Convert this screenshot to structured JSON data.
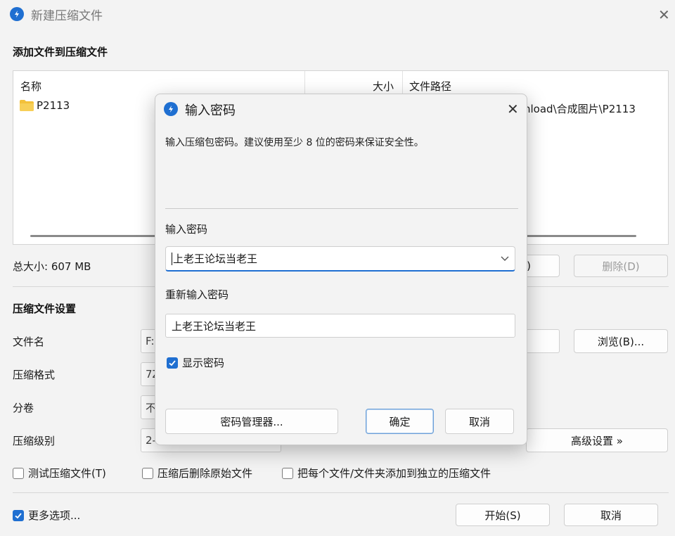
{
  "window": {
    "title": "新建压缩文件",
    "close_glyph": "✕"
  },
  "add_files": {
    "section_title": "添加文件到压缩文件",
    "columns": {
      "name": "名称",
      "size": "大小",
      "path": "文件路径"
    },
    "rows": [
      {
        "name": "P2113",
        "size": "",
        "path_visible": "nload\\合成图片\\P2113",
        "icon": "folder-icon"
      }
    ],
    "total_size": "总大小: 607 MB",
    "partial_button": ")",
    "delete_button": "删除(D)"
  },
  "settings": {
    "section_title": "压缩文件设置",
    "filename_label": "文件名",
    "filename_value": "F:",
    "browse_button": "浏览(B)...",
    "format_label": "压缩格式",
    "format_value": "7Z",
    "volume_label": "分卷",
    "volume_value": "不",
    "level_label": "压缩级别",
    "level_value": "2-",
    "advanced_button": "高级设置 »"
  },
  "options": {
    "test_archive": {
      "label": "测试压缩文件(T)",
      "checked": false
    },
    "delete_after": {
      "label": "压缩后删除原始文件",
      "checked": false
    },
    "separate_archives": {
      "label": "把每个文件/文件夹添加到独立的压缩文件",
      "checked": false
    },
    "more_options": {
      "label": "更多选项...",
      "checked": true
    }
  },
  "footer": {
    "start_button": "开始(S)",
    "cancel_button": "取消"
  },
  "dialog": {
    "title": "输入密码",
    "close_glyph": "✕",
    "description": "输入压缩包密码。建议使用至少 8 位的密码来保证安全性。",
    "password_label": "输入密码",
    "password_value": "上老王论坛当老王",
    "reenter_label": "重新输入密码",
    "reenter_value": "上老王论坛当老王",
    "show_password": {
      "label": "显示密码",
      "checked": true
    },
    "manager_button": "密码管理器...",
    "ok_button": "确定",
    "cancel_button": "取消"
  },
  "colors": {
    "accent": "#1f6fd1",
    "folder": "#f3c13a",
    "background": "#f3f3f3"
  }
}
